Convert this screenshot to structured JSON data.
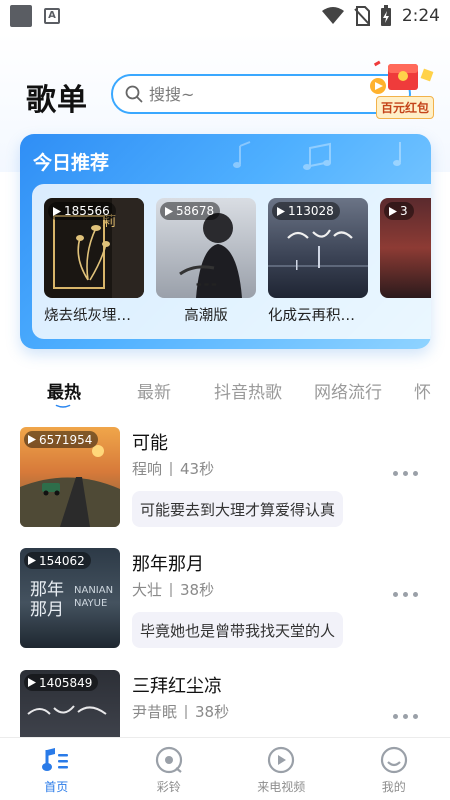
{
  "status_bar": {
    "time": "2:24"
  },
  "header": {
    "title": "歌单",
    "search": {
      "placeholder": "搜搜~",
      "value": ""
    },
    "red_packet_label": "百元红包"
  },
  "recommend": {
    "title": "今日推荐",
    "items": [
      {
        "play_count": "185566",
        "name": "烧去纸灰埋烟..."
      },
      {
        "play_count": "58678",
        "name": "高潮版"
      },
      {
        "play_count": "113028",
        "name": "化成云再积成..."
      },
      {
        "play_count": "3"
      }
    ]
  },
  "tabs": [
    "最热",
    "最新",
    "抖音热歌",
    "网络流行",
    "怀"
  ],
  "songs": [
    {
      "play_count": "6571954",
      "title": "可能",
      "artist": "程响",
      "duration": "43秒",
      "lyric": "可能要去到大理才算爱得认真"
    },
    {
      "play_count": "154062",
      "title": "那年那月",
      "artist": "大壮",
      "duration": "38秒",
      "lyric": "毕竟她也是曾带我找天堂的人",
      "cover_text_cn": "那年\n那月",
      "cover_text_en": "NANIAN\nNAYUE"
    },
    {
      "play_count": "1405849",
      "title": "三拜红尘凉",
      "artist": "尹昔眠",
      "duration": "38秒"
    }
  ],
  "bottom_nav": [
    {
      "label": "首页",
      "icon": "music-note-icon",
      "active": true
    },
    {
      "label": "彩铃",
      "icon": "ringtone-icon",
      "active": false
    },
    {
      "label": "来电视频",
      "icon": "video-play-icon",
      "active": false
    },
    {
      "label": "我的",
      "icon": "profile-icon",
      "active": false
    }
  ],
  "colors": {
    "accent": "#2a86f0",
    "search_border": "#3aa8ff",
    "panel_start": "#2f8ef5",
    "panel_end": "#8fd3ff"
  }
}
